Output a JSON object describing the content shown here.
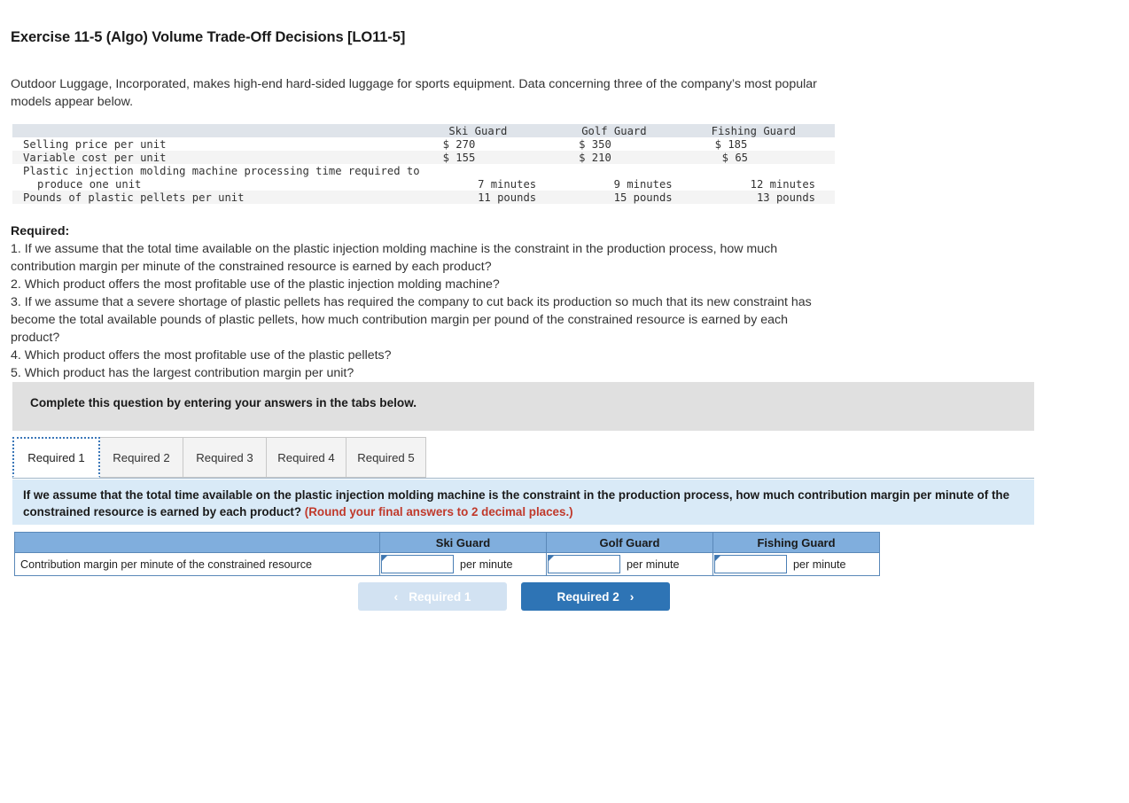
{
  "exercise": {
    "title": "Exercise 11-5 (Algo) Volume Trade-Off Decisions [LO11-5]",
    "intro": "Outdoor Luggage, Incorporated, makes high-end hard-sided luggage for sports equipment. Data concerning three of the company’s most popular models appear below."
  },
  "data_table": {
    "columns": [
      "",
      "Ski Guard",
      "Golf Guard",
      "Fishing Guard"
    ],
    "rows": [
      {
        "label": "Selling price per unit",
        "label_indent": false,
        "values": [
          "$ 270",
          "$ 350",
          "$ 185"
        ],
        "align": "money",
        "shade": false
      },
      {
        "label": "Variable cost per unit",
        "label_indent": false,
        "values": [
          "$ 155",
          "$ 210",
          "$ 65"
        ],
        "align": "money",
        "shade": true
      },
      {
        "label": "Plastic injection molding machine processing time required to",
        "label_indent": false,
        "values": [
          "",
          "",
          ""
        ],
        "align": "num",
        "shade": false
      },
      {
        "label": "produce one unit",
        "label_indent": true,
        "values": [
          "7 minutes",
          "9 minutes",
          "12 minutes"
        ],
        "align": "num",
        "shade": false
      },
      {
        "label": "Pounds of plastic pellets per unit",
        "label_indent": false,
        "values": [
          "11 pounds",
          "15 pounds",
          "13 pounds"
        ],
        "align": "num",
        "shade": true
      }
    ]
  },
  "required": {
    "heading": "Required:",
    "items": [
      "1. If we assume that the total time available on the plastic injection molding machine is the constraint in the production process, how much contribution margin per minute of the constrained resource is earned by each product?",
      "2. Which product offers the most profitable use of the plastic injection molding machine?",
      "3. If we assume that a severe shortage of plastic pellets has required the company to cut back its production so much that its new constraint has become the total available pounds of plastic pellets, how much contribution margin per pound of the constrained resource is earned by each product?",
      "4. Which product offers the most profitable use of the plastic pellets?",
      "5. Which product has the largest contribution margin per unit?"
    ]
  },
  "banner": {
    "text": "Complete this question by entering your answers in the tabs below."
  },
  "tabs": {
    "items": [
      {
        "label": "Required 1",
        "active": true
      },
      {
        "label": "Required 2",
        "active": false
      },
      {
        "label": "Required 3",
        "active": false
      },
      {
        "label": "Required 4",
        "active": false
      },
      {
        "label": "Required 5",
        "active": false
      }
    ]
  },
  "instruction": {
    "question": "If we assume that the total time available on the plastic injection molding machine is the constraint in the production process, how much contribution margin per minute of the constrained resource is earned by each product?",
    "round_note": "(Round your final answers to 2 decimal places.)",
    "note_color": "#c0392b"
  },
  "answer_table": {
    "headers": [
      "",
      "Ski Guard",
      "Golf Guard",
      "Fishing Guard"
    ],
    "row_label": "Contribution margin per minute of the constrained resource",
    "cells": [
      {
        "value": "",
        "unit": "per minute"
      },
      {
        "value": "",
        "unit": "per minute"
      },
      {
        "value": "",
        "unit": "per minute"
      }
    ],
    "header_color": "#80aedd"
  },
  "navigation": {
    "prev": {
      "label": "Required 1",
      "icon": "chevron-left",
      "glyph": "‹",
      "disabled": true
    },
    "next": {
      "label": "Required 2",
      "icon": "chevron-right",
      "glyph": "›",
      "disabled": false
    },
    "active_color": "#2e74b5",
    "disabled_color": "#d2e2f2"
  }
}
